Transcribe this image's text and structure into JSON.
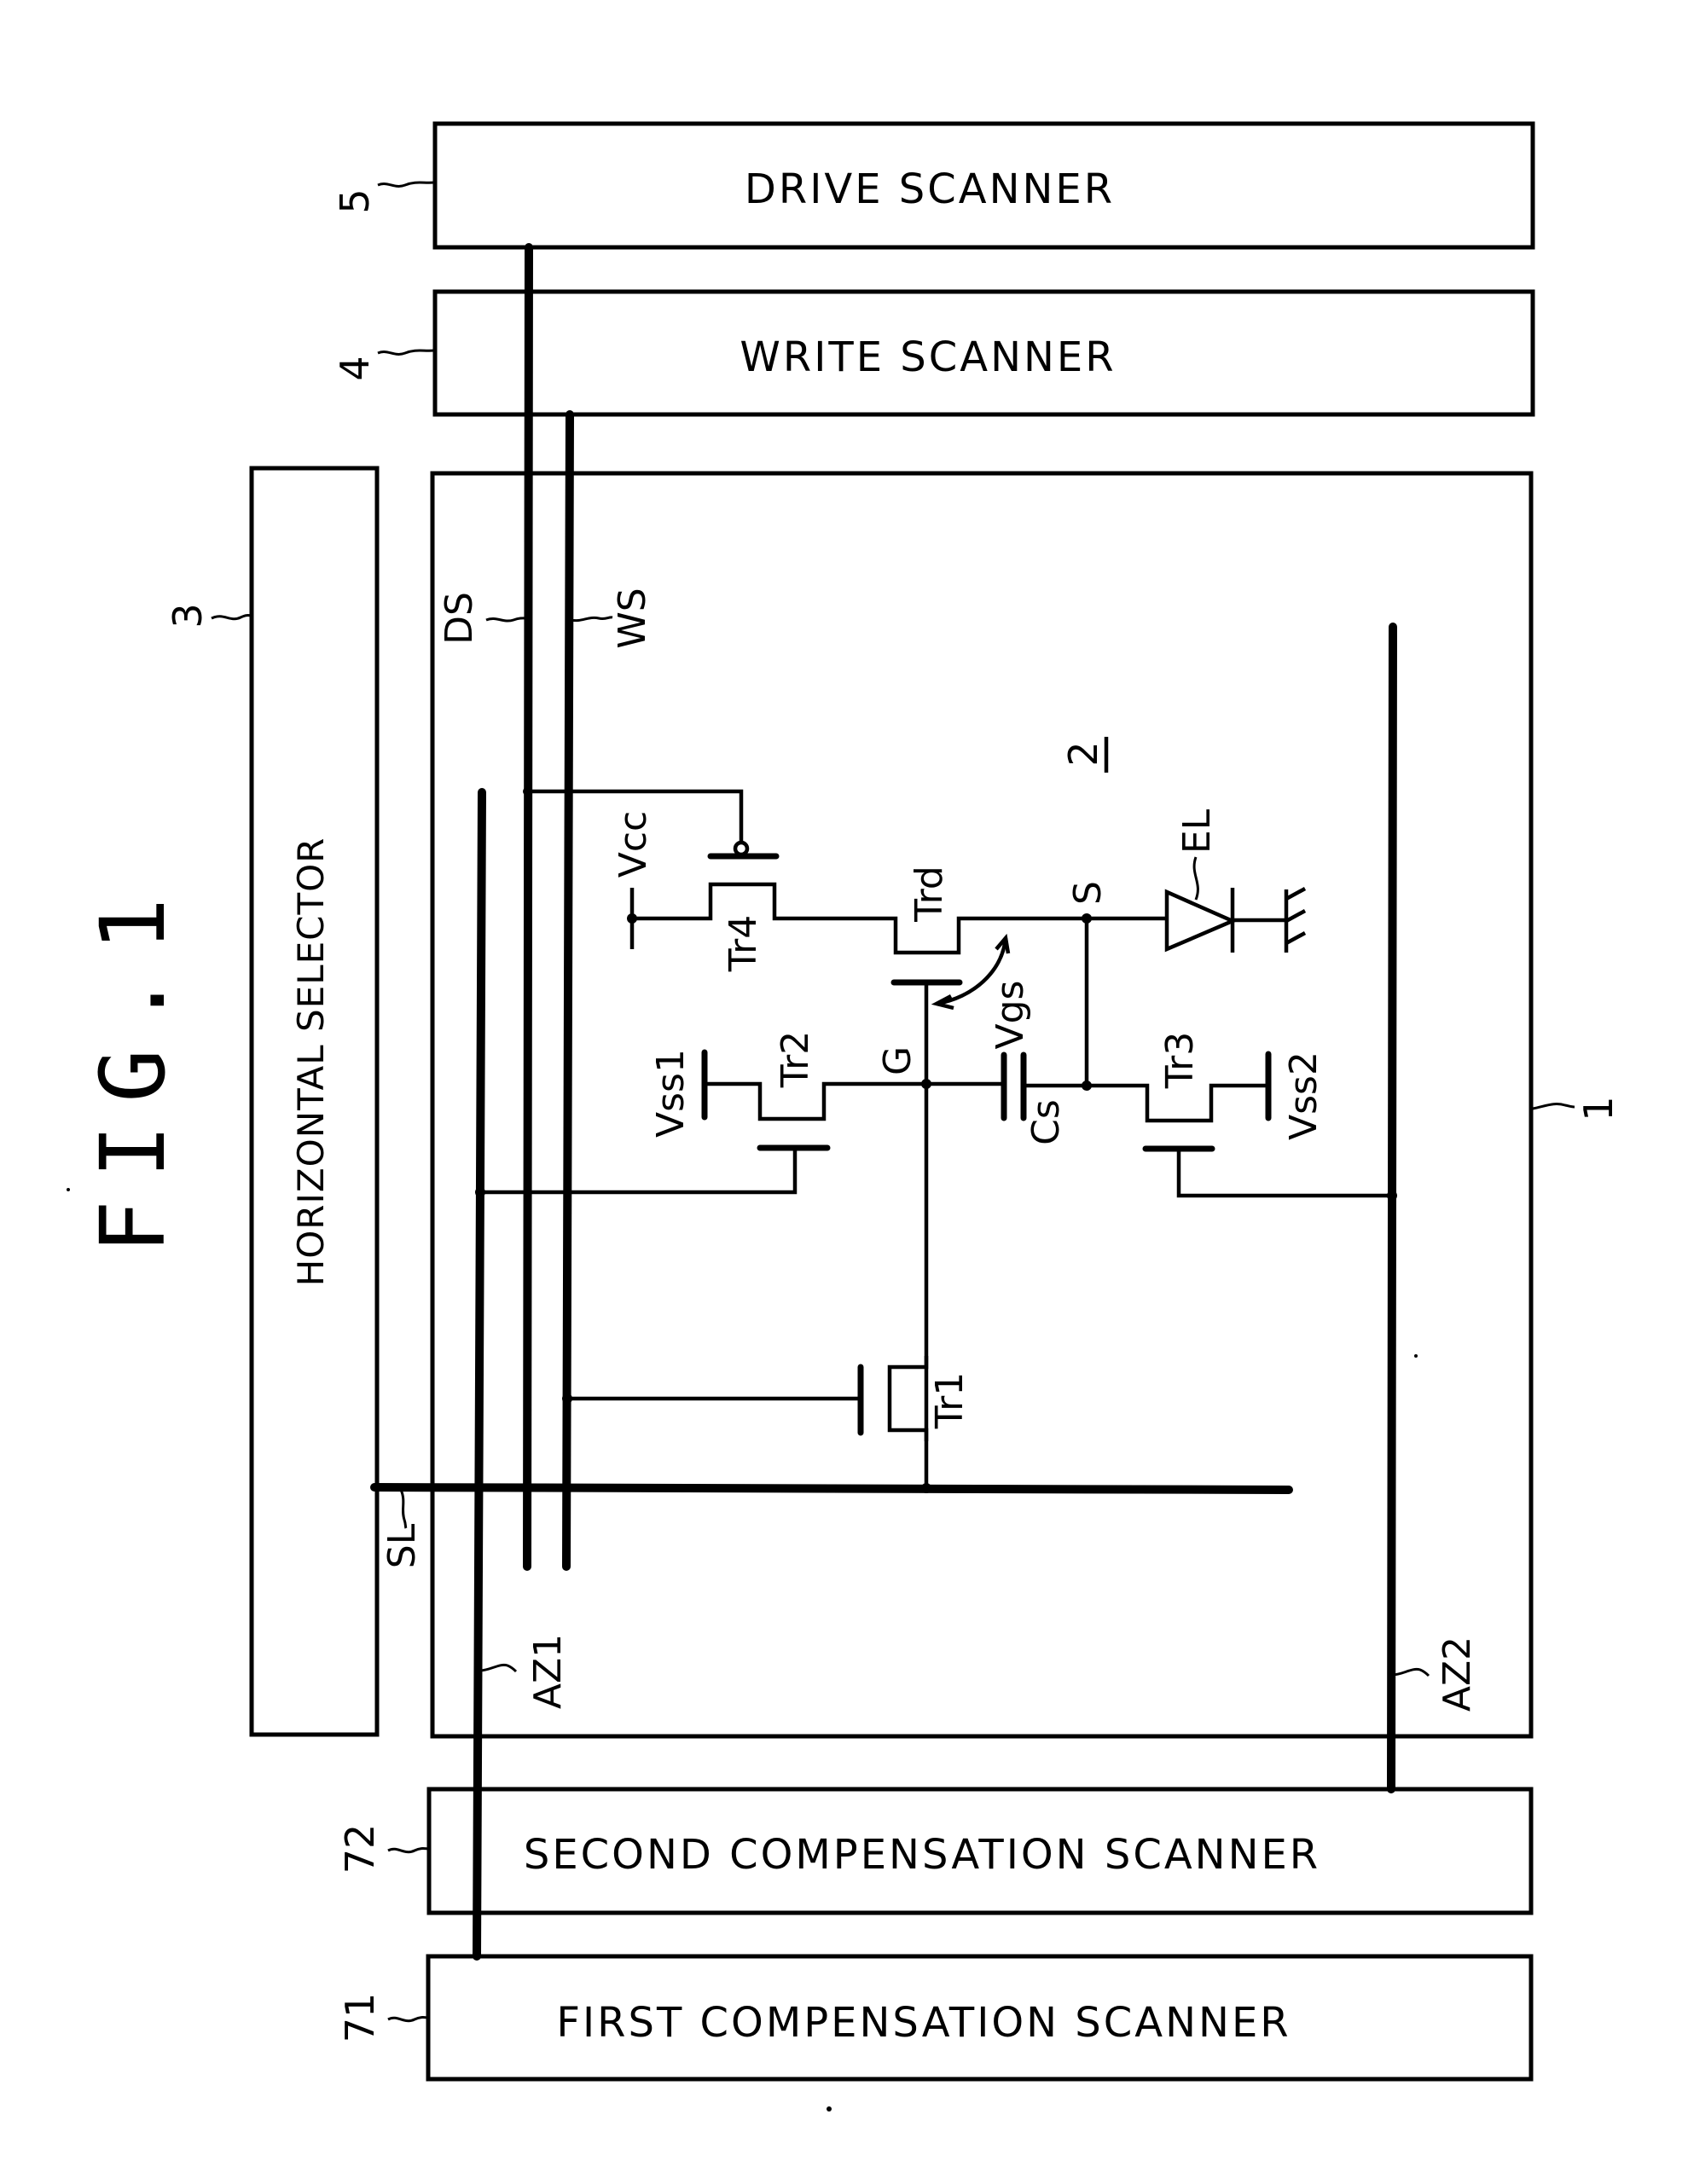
{
  "figure": {
    "title": "FIG.1"
  },
  "blocks": {
    "drive_scanner": {
      "label": "DRIVE SCANNER",
      "ref": "5"
    },
    "write_scanner": {
      "label": "WRITE SCANNER",
      "ref": "4"
    },
    "horizontal_selector": {
      "label": "HORIZONTAL SELECTOR",
      "ref": "3"
    },
    "pixel_array": {
      "ref": "1"
    },
    "second_compensation_scanner": {
      "label": "SECOND COMPENSATION SCANNER",
      "ref": "72"
    },
    "first_compensation_scanner": {
      "label": "FIRST COMPENSATION SCANNER",
      "ref": "71"
    }
  },
  "signal_lines": {
    "ds": "DS",
    "ws": "WS",
    "sl": "SL",
    "az1": "AZ1",
    "az2": "AZ2"
  },
  "pixel_circuit": {
    "ref": "2",
    "components": {
      "tr1": "Tr1",
      "tr2": "Tr2",
      "tr3": "Tr3",
      "tr4": "Tr4",
      "trd": "Trd",
      "cs": "Cs",
      "el": "EL"
    },
    "nodes": {
      "g": "G",
      "s": "S",
      "vgs": "Vgs"
    },
    "supplies": {
      "vcc": "Vcc",
      "vss1": "Vss1",
      "vss2": "Vss2"
    }
  }
}
